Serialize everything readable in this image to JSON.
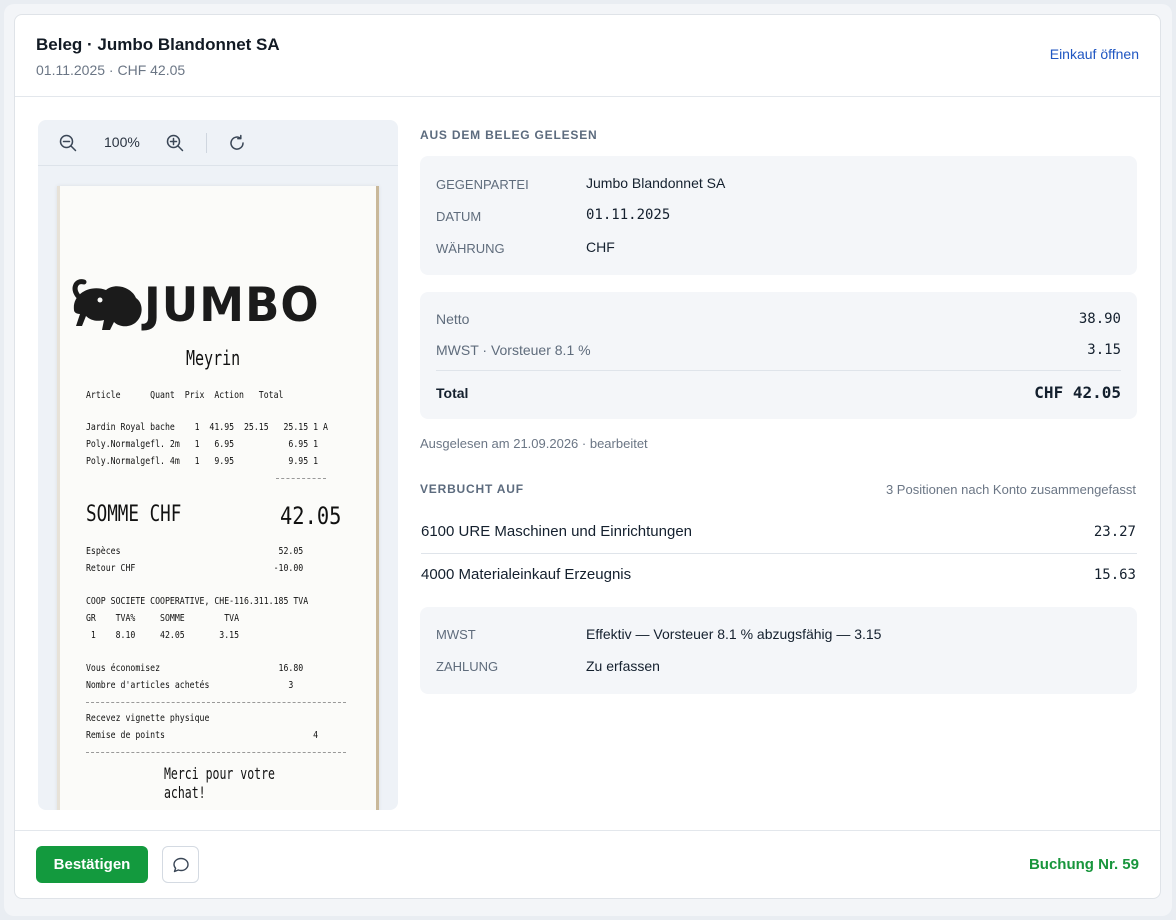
{
  "header": {
    "title": "Beleg · Jumbo Blandonnet SA",
    "subtitle": "01.11.2025 · CHF 42.05",
    "open_purchase_link": "Einkauf öffnen"
  },
  "viewer": {
    "zoom_out_icon": "zoom-out-icon",
    "zoom_level": "100%",
    "zoom_in_icon": "zoom-in-icon",
    "rotate_icon": "rotate-icon",
    "receipt": {
      "logo": "JUMBO",
      "city": "Meyrin",
      "header_cols": "Article      Quant  Prix  Action   Total",
      "items": [
        "Jardin Royal bache    1  41.95  25.15   25.15 1 A",
        "Poly.Normalgefl. 2m   1   6.95           6.95 1",
        "Poly.Normalgefl. 4m   1   9.95           9.95 1"
      ],
      "somme_label": "SOMME CHF",
      "somme_value": "42.05",
      "especes": "Espèces                                52.05",
      "retour": "Retour CHF                            -10.00",
      "coop_line": "COOP SOCIETE COOPERATIVE, CHE-116.311.185 TVA",
      "tva_header": "GR    TVA%     SOMME        TVA",
      "tva_row": " 1    8.10     42.05       3.15",
      "economisez": "Vous économisez                        16.80",
      "articles": "Nombre d'articles achetés                3",
      "vignette": "Recevez vignette physique",
      "points": "Remise de points                              4",
      "merci": "Merci pour votre achat!"
    }
  },
  "read_section": {
    "label": "AUS DEM BELEG GELESEN",
    "fields": [
      {
        "key": "GEGENPARTEI",
        "value": "Jumbo Blandonnet SA"
      },
      {
        "key": "DATUM",
        "value": "01.11.2025"
      },
      {
        "key": "WÄHRUNG",
        "value": "CHF"
      }
    ],
    "amounts": {
      "netto_label": "Netto",
      "netto_value": "38.90",
      "mwst_label": "MWST · Vorsteuer 8.1 %",
      "mwst_value": "3.15",
      "total_label": "Total",
      "total_value": "CHF 42.05"
    },
    "meta": "Ausgelesen am 21.09.2026 · bearbeitet"
  },
  "booked_section": {
    "label": "VERBUCHT AUF",
    "summary": "3 Positionen nach Konto zusammengefasst",
    "rows": [
      {
        "account": "6100 URE Maschinen und Einrichtungen",
        "amount": "23.27"
      },
      {
        "account": "4000 Materialeinkauf Erzeugnis",
        "amount": "15.63"
      }
    ],
    "details": [
      {
        "key": "MWST",
        "value": "Effektiv — Vorsteuer 8.1 % abzugsfähig — 3.15"
      },
      {
        "key": "ZAHLUNG",
        "value": "Zu erfassen"
      }
    ]
  },
  "footer": {
    "confirm_label": "Bestätigen",
    "comment_icon": "comment-icon",
    "booking_number": "Buchung Nr. 59"
  },
  "colors": {
    "accent_link": "#1f56c2",
    "confirm_green": "#139a3e",
    "booking_green": "#18953c"
  }
}
